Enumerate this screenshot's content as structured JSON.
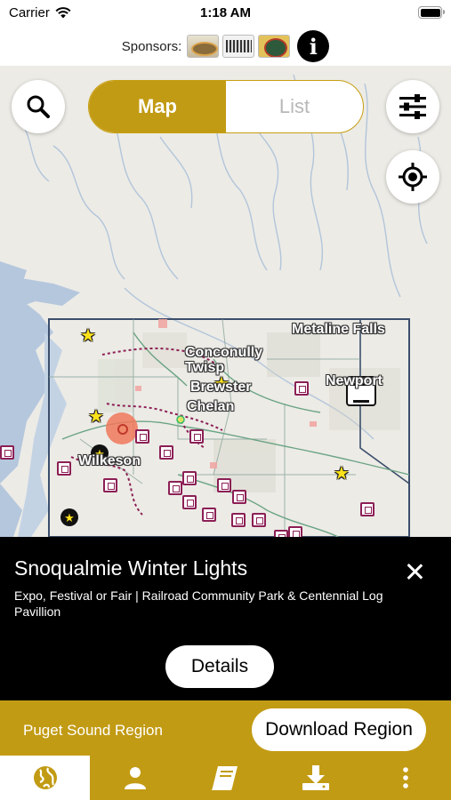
{
  "status_bar": {
    "carrier": "Carrier",
    "time": "1:18 AM"
  },
  "sponsors": {
    "label": "Sponsors:",
    "logos": [
      "sponsor-logo-1",
      "sponsor-logo-2",
      "sponsor-logo-3"
    ],
    "info_icon": "info-icon"
  },
  "map": {
    "view_toggle": {
      "map_label": "Map",
      "list_label": "List",
      "selected": "Map"
    },
    "search_icon": "search-icon",
    "filter_icon": "sliders-icon",
    "locate_icon": "crosshair-icon",
    "places": {
      "metaline_falls": "Metaline Falls",
      "conconully": "Conconully",
      "twisp": "Twisp",
      "brewster": "Brewster",
      "chelan": "Chelan",
      "newport": "Newport",
      "wilkeson": "Wilkeson"
    }
  },
  "detail": {
    "title": "Snoqualmie Winter Lights",
    "subtitle": "Expo, Festival or Fair | Railroad Community Park & Centennial Log Pavillion",
    "details_label": "Details",
    "close_icon": "close-icon"
  },
  "region": {
    "name": "Puget Sound Region",
    "download_label": "Download Region"
  },
  "tabs": [
    {
      "icon": "globe-icon",
      "active": true
    },
    {
      "icon": "person-icon",
      "active": false
    },
    {
      "icon": "book-icon",
      "active": false
    },
    {
      "icon": "download-icon",
      "active": false
    },
    {
      "icon": "more-vertical-icon",
      "active": false
    }
  ],
  "colors": {
    "accent": "#c29b14",
    "panel_bg": "#000000",
    "marker": "#8c1f55",
    "star": "#ffe21a"
  }
}
